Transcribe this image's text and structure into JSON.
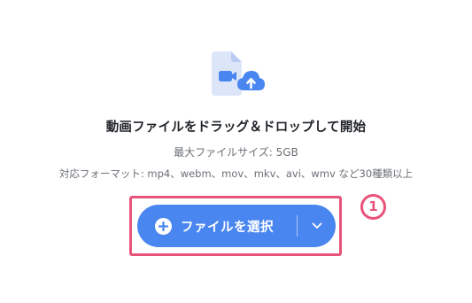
{
  "dropzone": {
    "title": "動画ファイルをドラッグ＆ドロップして開始",
    "max_size": "最大ファイルサイズ: 5GB",
    "formats": "対応フォーマット: mp4、webm、mov、mkv、avi、wmv など30種類以上",
    "illustration_icon": "video-file-upload-icon"
  },
  "select_button": {
    "label": "ファイルを選択",
    "plus_icon": "plus-circle-icon",
    "dropdown_icon": "chevron-down-icon"
  },
  "annotation": {
    "step_number": "1"
  },
  "colors": {
    "button_blue": "#4a86f0",
    "highlight_pink": "#e8537a",
    "file_icon_light": "#dde6f8",
    "file_icon_fold": "#b9cdf3",
    "cloud_blue": "#4a86f0",
    "text_dark": "#1f2328",
    "text_muted": "#6b6f76"
  }
}
